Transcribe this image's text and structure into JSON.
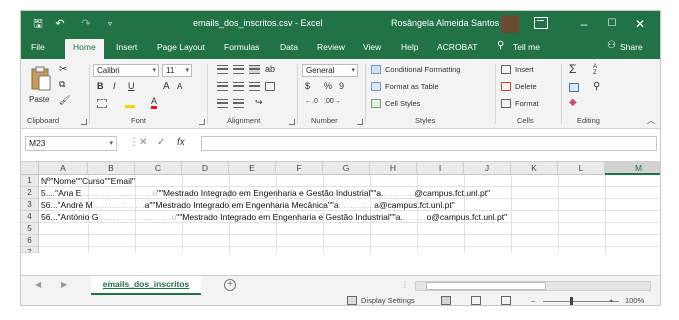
{
  "window": {
    "title": "emails_dos_inscritos.csv  -  Excel",
    "user": "Rosângela Almeida Santos",
    "minimize": "–",
    "maximize": "☐",
    "close": "✕"
  },
  "quick_access": {
    "save": "🖫",
    "undo": "↶",
    "redo": "↷",
    "customize": "▿"
  },
  "ribbon_tabs": [
    "File",
    "Home",
    "Insert",
    "Page Layout",
    "Formulas",
    "Data",
    "Review",
    "View",
    "Help",
    "ACROBAT"
  ],
  "active_tab": "Home",
  "tell_me": "Tell me",
  "share": "Share",
  "ribbon": {
    "clipboard": {
      "paste": "Paste",
      "label": "Clipboard"
    },
    "font": {
      "name": "Calibri",
      "size": "11",
      "bold": "B",
      "italic": "I",
      "underline": "U",
      "grow": "A",
      "shrink": "A",
      "color_letter": "A",
      "label": "Font"
    },
    "alignment": {
      "label": "Alignment"
    },
    "number": {
      "format": "General",
      "currency": "$",
      "percent": "%",
      "comma": "9",
      "label": "Number"
    },
    "styles": {
      "conditional": "Conditional Formatting",
      "as_table": "Format as Table",
      "cell_styles": "Cell Styles",
      "label": "Styles"
    },
    "cells": {
      "insert": "Insert",
      "delete": "Delete",
      "format": "Format",
      "label": "Cells"
    },
    "editing": {
      "sum": "Σ",
      "sort": "A Z",
      "label": "Editing"
    }
  },
  "formula_bar": {
    "name_box": "M23",
    "cancel": "✕",
    "enter": "✓",
    "fx": "fx",
    "value": ""
  },
  "columns": [
    "A",
    "B",
    "C",
    "D",
    "E",
    "F",
    "G",
    "H",
    "I",
    "J",
    "K",
    "L",
    "M"
  ],
  "selected_column": "M",
  "rows": [
    "1",
    "2",
    "3",
    "4",
    "5",
    "6",
    "7"
  ],
  "cells": [
    {
      "row": "1",
      "parts": [
        {
          "t": "Nº\"Nome\"\"Curso\"\"Email\"",
          "blur": false
        }
      ]
    },
    {
      "row": "2",
      "parts": [
        {
          "t": "5....\"Ana E",
          "blur": false
        },
        {
          "t": "..............................o",
          "blur": true
        },
        {
          "t": "\"\"Mestrado Integrado em Engenharia e Gestão Industrial\"\"a.",
          "blur": false
        },
        {
          "t": ".............",
          "blur": true
        },
        {
          "t": "@campus.fct.unl.pt\"",
          "blur": false
        }
      ]
    },
    {
      "row": "3",
      "parts": [
        {
          "t": "56...\"André M",
          "blur": false
        },
        {
          "t": "......................",
          "blur": true
        },
        {
          "t": "a\"\"Mestrado Integrado em Engenharia Mecânica\"\"a",
          "blur": false
        },
        {
          "t": "...............",
          "blur": true
        },
        {
          "t": "a@campus.fct.unl.pt\"",
          "blur": false
        }
      ]
    },
    {
      "row": "4",
      "parts": [
        {
          "t": "56...\"António G",
          "blur": false
        },
        {
          "t": "...............................o",
          "blur": true
        },
        {
          "t": "\"\"Mestrado Integrado em Engenharia e Gestão Industrial\"\"a.",
          "blur": false
        },
        {
          "t": "..........",
          "blur": true
        },
        {
          "t": "o@campus.fct.unl.pt\"",
          "blur": false
        }
      ]
    }
  ],
  "sheet_tab": "emails_dos_inscritos",
  "add_sheet": "+",
  "status": {
    "display_settings": "Display Settings",
    "zoom": "100%",
    "zoom_minus": "–",
    "zoom_plus": "+"
  },
  "colors": {
    "accent": "#217346",
    "ribbon_bg": "#f3f3f3",
    "header_bg": "#eaeaea"
  }
}
